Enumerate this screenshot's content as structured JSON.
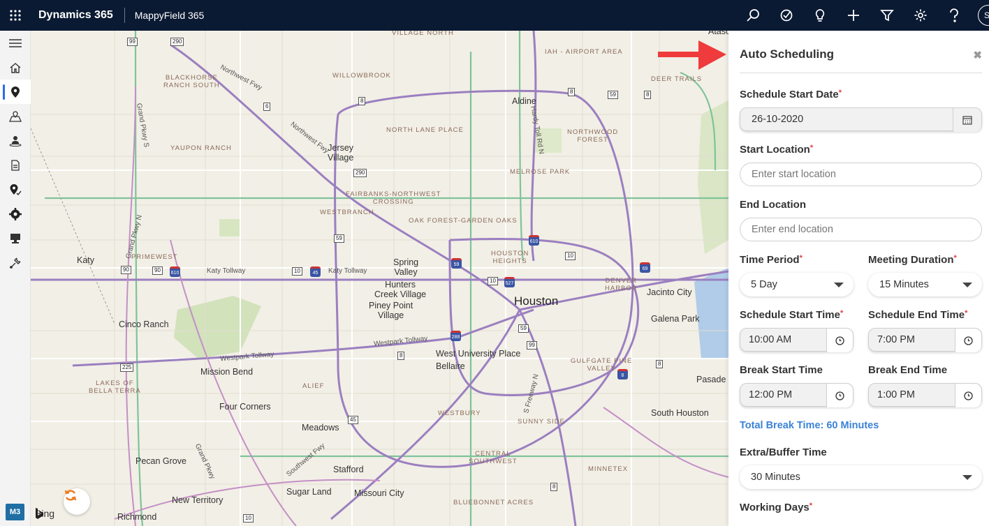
{
  "topbar": {
    "brand": "Dynamics 365",
    "app_name": "MappyField 365",
    "avatar_initials": "S("
  },
  "leftnav": {
    "items": [
      "menu-icon",
      "home-icon",
      "map-pin-icon",
      "map-route-icon",
      "person-pin-icon",
      "document-icon",
      "pin-check-icon",
      "settings-icon",
      "monitor-icon",
      "tools-icon"
    ],
    "badge": "M3"
  },
  "map": {
    "attribution": "Bing",
    "labels": {
      "houston": "Houston",
      "katy": "Katy",
      "cinco_ranch": "Cinco Ranch",
      "mission_bend": "Mission Bend",
      "four_corners": "Four Corners",
      "meadows": "Meadows",
      "pecan_grove": "Pecan Grove",
      "stafford": "Stafford",
      "sugar_land": "Sugar Land",
      "missouri_city": "Missouri City",
      "new_territory": "New Territory",
      "richmond": "Richmond",
      "spring_valley": "Spring\nValley",
      "hunters_creek": "Hunters\nCreek Village",
      "piney_point": "Piney Point\nVillage",
      "west_university": "West University Place",
      "bellaire": "Bellaire",
      "aldine": "Aldine",
      "jersey_village": "Jersey\nVillage",
      "jacinto_city": "Jacinto City",
      "galena_park": "Galena Park",
      "south_houston": "South Houston",
      "pasadena": "Pasade",
      "village_north": "VILLAGE NORTH",
      "iah_airport": "IAH - AIRPORT AREA",
      "deer_trails": "DEER TRAILS",
      "willowbrook": "WILLOWBROOK",
      "blackhorse": "BLACKHORSE\nRANCH SOUTH",
      "yaupon_ranch": "YAUPON RANCH",
      "north_lane": "NORTH LANE PLACE",
      "northwood_forest": "NORTHWOOD\nFOREST",
      "melrose_park": "MELROSE PARK",
      "fairbanks": "FAIRBANKS-NORTHWEST\nCROSSING",
      "westbranch": "WESTBRANCH",
      "oak_forest": "OAK FOREST-GARDEN OAKS",
      "primewest": "PRIMEWEST",
      "houston_heights": "HOUSTON\nHEIGHTS",
      "denver_harbor": "DENVER\nHARBOR",
      "alief": "ALIEF",
      "lakes_bella": "LAKES OF\nBELLA TERRA",
      "gulfgate": "GULFGATE PINE\nVALLEY",
      "westbury": "WESTBURY",
      "sunny_side": "SUNNY SIDE",
      "central_sw": "CENTRAL\nSOUTHWEST",
      "minnetex": "MINNETEX",
      "bluebonnet": "BLUEBONNET ACRES",
      "katy_tollway_1": "Katy Tollway",
      "katy_tollway_2": "Katy Tollway",
      "westpark_1": "Westpark Tollway",
      "westpark_2": "Westpark Tollway",
      "northwest_fwy_1": "Northwest Fwy",
      "northwest_fwy_2": "Northwest Fwy",
      "grand_pkwy_s": "Grand Pkwy S",
      "grand_pkwy_n": "Grand Pkwy N",
      "hardy_toll": "Hardy Toll Rd N",
      "southwest_fwy": "Southwest Fwy",
      "s_freeway": "S Freeway N",
      "grand_pkwy": "Grand Pkwy",
      "atascocita": "Atasc"
    },
    "shields": [
      "99",
      "290",
      "6",
      "290",
      "8",
      "8",
      "8",
      "59",
      "90",
      "90",
      "10",
      "10",
      "610",
      "45",
      "59",
      "610",
      "10",
      "69",
      "527",
      "288",
      "59",
      "99",
      "8",
      "225",
      "45",
      "8",
      "8",
      "59",
      "10",
      "8"
    ]
  },
  "panel": {
    "title": "Auto Scheduling",
    "schedule_start_date": {
      "label": "Schedule Start Date",
      "value": "26-10-2020"
    },
    "start_location": {
      "label": "Start Location",
      "placeholder": "Enter start location"
    },
    "end_location": {
      "label": "End Location",
      "placeholder": "Enter end location"
    },
    "time_period": {
      "label": "Time Period",
      "value": "5 Day"
    },
    "meeting_duration": {
      "label": "Meeting Duration",
      "value": "15 Minutes"
    },
    "schedule_start_time": {
      "label": "Schedule Start Time",
      "value": "10:00 AM"
    },
    "schedule_end_time": {
      "label": "Schedule End Time",
      "value": "7:00 PM"
    },
    "break_start_time": {
      "label": "Break Start Time",
      "value": "12:00 PM"
    },
    "break_end_time": {
      "label": "Break End Time",
      "value": "1:00 PM"
    },
    "total_break": "Total Break Time: 60 Minutes",
    "buffer_time": {
      "label": "Extra/Buffer Time",
      "value": "30 Minutes"
    },
    "working_days": {
      "label": "Working Days"
    },
    "required_mark": "*"
  },
  "colors": {
    "topbar": "#0b1a33",
    "accent": "#3b82d6",
    "required": "#e23b3b",
    "arrow": "#ef3b3b"
  }
}
